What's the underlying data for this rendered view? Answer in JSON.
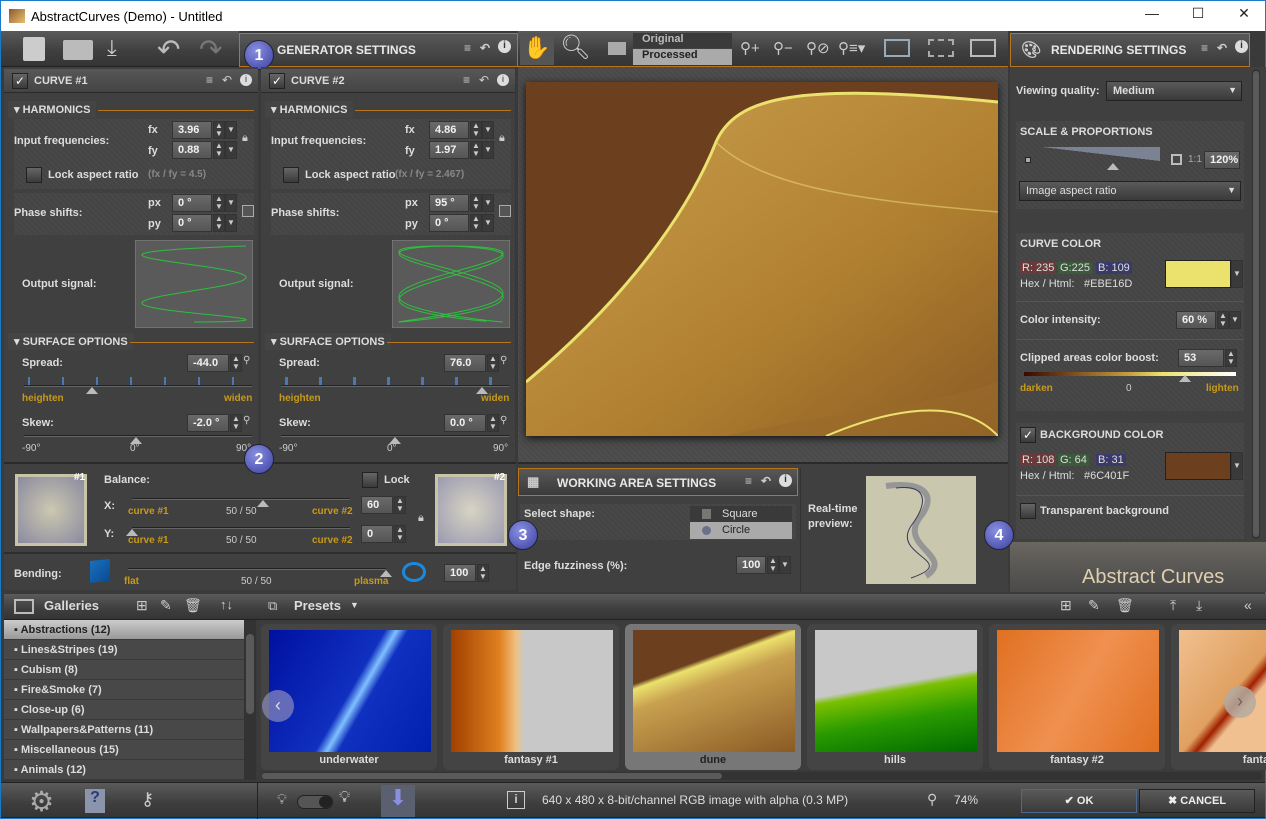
{
  "window": {
    "title": "AbstractCurves (Demo) - Untitled",
    "minimize": "—",
    "maximize": "☐",
    "close": "✕"
  },
  "toolbar": {
    "icons": [
      "new-image-icon",
      "open-folder-icon",
      "save-download-icon",
      "undo-icon",
      "redo-icon"
    ]
  },
  "generator": {
    "title": "GENERATOR SETTINGS",
    "marker": "1"
  },
  "view_toolbar": {
    "original": "Original",
    "processed": "Processed"
  },
  "curves": [
    {
      "title": "CURVE #1",
      "checked": true,
      "harmonics": "HARMONICS",
      "input_freq_label": "Input frequencies:",
      "fx_label": "fx",
      "fy_label": "fy",
      "fx": "3.96",
      "fy": "0.88",
      "lock_label": "Lock aspect ratio",
      "ratio": "(fx / fy = 4.5)",
      "phase_label": "Phase shifts:",
      "px_label": "px",
      "py_label": "py",
      "px": "0 °",
      "py": "0 °",
      "output_label": "Output signal:",
      "surface": "SURFACE OPTIONS",
      "spread_label": "Spread:",
      "spread": "-44.0",
      "heighten": "heighten",
      "widen": "widen",
      "skew_label": "Skew:",
      "skew": "-2.0 °",
      "skew_min": "-90°",
      "skew_mid": "0°",
      "skew_max": "90°",
      "spread_pos": 0.3,
      "skew_pos": 0.49,
      "fx_num": 3.96,
      "fy_num": 0.88
    },
    {
      "title": "CURVE #2",
      "checked": true,
      "harmonics": "HARMONICS",
      "input_freq_label": "Input frequencies:",
      "fx_label": "fx",
      "fy_label": "fy",
      "fx": "4.86",
      "fy": "1.97",
      "lock_label": "Lock aspect ratio",
      "ratio": "(fx / fy = 2.467)",
      "phase_label": "Phase shifts:",
      "px_label": "px",
      "py_label": "py",
      "px": "95 °",
      "py": "0 °",
      "output_label": "Output signal:",
      "surface": "SURFACE OPTIONS",
      "spread_label": "Spread:",
      "spread": "76.0",
      "heighten": "heighten",
      "widen": "widen",
      "skew_label": "Skew:",
      "skew": "0.0 °",
      "skew_min": "-90°",
      "skew_mid": "0°",
      "skew_max": "90°",
      "spread_pos": 0.88,
      "skew_pos": 0.5,
      "fx_num": 4.86,
      "fy_num": 1.97
    }
  ],
  "balance": {
    "label": "Balance:",
    "marker": "2",
    "lock": "Lock",
    "thumb1": "#1",
    "thumb2": "#2",
    "x_label": "X:",
    "y_label": "Y:",
    "left": "curve #1",
    "mid": "50 / 50",
    "right": "curve #2",
    "x": "60",
    "y": "0",
    "x_pos": 0.6,
    "y_pos": 0.0
  },
  "bending": {
    "label": "Bending:",
    "left": "flat",
    "mid": "50 / 50",
    "right": "plasma",
    "value": "100",
    "pos": 1.0
  },
  "working_area": {
    "title": "WORKING AREA SETTINGS",
    "marker": "3",
    "select_shape": "Select shape:",
    "shapes": [
      "Square",
      "Circle"
    ],
    "selected": "Circle",
    "fuzz_label": "Edge fuzziness (%):",
    "fuzz": "100",
    "preview_label": "Real-time preview:"
  },
  "rendering": {
    "title": "RENDERING SETTINGS",
    "marker": "4",
    "quality_label": "Viewing quality:",
    "quality": "Medium",
    "scale_title": "SCALE & PROPORTIONS",
    "one_to_one": "1:1",
    "scale": "120%",
    "scale_pos": 0.6,
    "aspect": "Image aspect ratio",
    "curve_color": {
      "title": "CURVE COLOR",
      "r": "R: 235",
      "g": "G:225",
      "b": "B: 109",
      "hex_label": "Hex / Html:",
      "hex": "#EBE16D",
      "swatch": "#EBE16D"
    },
    "intensity_label": "Color intensity:",
    "intensity": "60 %",
    "boost_label": "Clipped areas color boost:",
    "boost": "53",
    "darken": "darken",
    "zero": "0",
    "lighten": "lighten",
    "boost_pos": 0.76,
    "bg_color": {
      "title": "BACKGROUND COLOR",
      "checked": true,
      "r": "R: 108",
      "g": "G:  64",
      "b": "B:  31",
      "hex_label": "Hex / Html:",
      "hex": "#6C401F",
      "swatch": "#6C401F"
    },
    "transparent": "Transparent background",
    "logo": "Abstract Curves"
  },
  "galleries": {
    "title": "Galleries",
    "items": [
      "Abstractions (12)",
      "Lines&Stripes (19)",
      "Cubism (8)",
      "Fire&Smoke (7)",
      "Close-up (6)",
      "Wallpapers&Patterns (11)",
      "Miscellaneous (15)",
      "Animals (12)"
    ],
    "selected": 0
  },
  "presets": {
    "title": "Presets",
    "items": [
      "underwater",
      "fantasy #1",
      "dune",
      "hills",
      "fantasy #2",
      "fantas"
    ],
    "selected": 2
  },
  "status": {
    "info": "640 x 480 x 8-bit/channel RGB image with alpha  (0.3 MP)",
    "zoom": "74%",
    "ok": "OK",
    "cancel": "CANCEL"
  },
  "colors": {
    "accent": "#B8741A",
    "label_gold": "#C89A1A",
    "curve": "#EBE16D",
    "background": "#6C401F"
  }
}
